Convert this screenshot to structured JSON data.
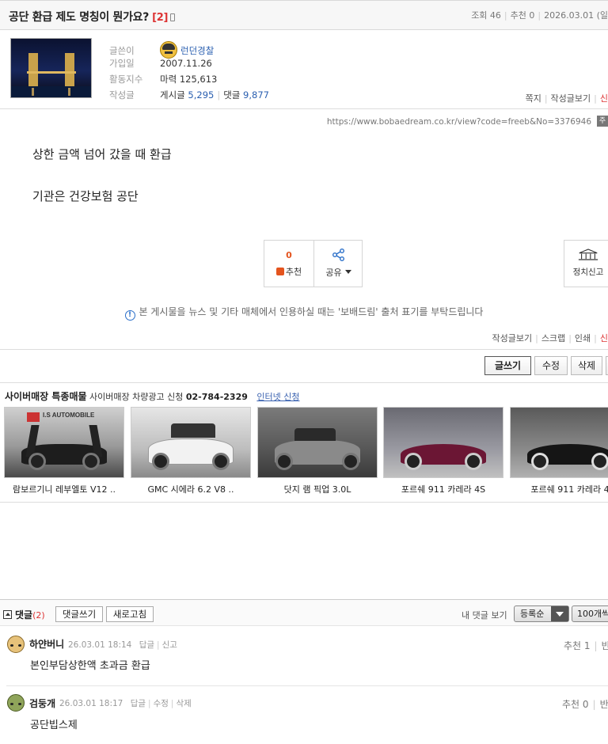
{
  "post": {
    "title": "공단 환급 제도 명칭이 뭔가요?",
    "comment_count": "[2]",
    "views_label": "조회 46",
    "recommend_label": "추천 0",
    "date": "2026.03.01 (일"
  },
  "author": {
    "writer_label": "글쓴이",
    "nickname": "런던경찰",
    "joined_label": "가입일",
    "joined": "2007.11.26",
    "activity_label": "활동지수",
    "activity": "마력 125,613",
    "posts_label": "작성글",
    "posts_prefix": "게시글",
    "posts_count": "5,295",
    "replies_prefix": "댓글",
    "replies_count": "9,877",
    "links": [
      "쪽지",
      "작성글보기",
      "신"
    ]
  },
  "url": "https://www.bobaedream.co.kr/view?code=freeb&No=3376946",
  "url_copy_label": "주",
  "body": {
    "line1": "상한 금액 넘어 갔을 때 환급",
    "line2": "기관은 건강보험 공단"
  },
  "actions": {
    "recommend_count": "0",
    "recommend_label": "추천",
    "share_label": "공유",
    "political_report_label": "정치신고"
  },
  "notice": "본 게시물을 뉴스 및 기타 매체에서 인용하실 때는 '보배드림' 출처 표기를 부탁드립니다",
  "post_tools": [
    "작성글보기",
    "스크랩",
    "인쇄",
    "신"
  ],
  "buttons": {
    "write": "글쓰기",
    "edit": "수정",
    "delete": "삭제"
  },
  "cyber": {
    "title": "사이버매장 특종매물",
    "ad_text": "사이버매장 차량광고 신청",
    "phone": "02-784-2329",
    "online_apply": "인터넷 신청",
    "cars": [
      {
        "caption": "람보르기니 레부엘토 V12 ..",
        "badge": "I.S AUTOMOBILE"
      },
      {
        "caption": "GMC 시에라 6.2 V8 .."
      },
      {
        "caption": "닷지 램 픽업 3.0L"
      },
      {
        "caption": "포르쉐 911 카레라 4S"
      },
      {
        "caption": "포르쉐 911 카레라 4"
      }
    ]
  },
  "comments_bar": {
    "title": "댓글",
    "count": "(2)",
    "write_button": "댓글쓰기",
    "refresh_button": "새로고침",
    "my_comments": "내 댓글 보기",
    "sort_value": "등록순",
    "per_page": "100개씩"
  },
  "comments": [
    {
      "name": "하얀버니",
      "datetime": "26.03.01 18:14",
      "actions": [
        "답글",
        "신고"
      ],
      "recommend": "추천 1",
      "oppose": "반",
      "text": "본인부담상한액 초과금 환급"
    },
    {
      "name": "검둥개",
      "datetime": "26.03.01 18:17",
      "actions": [
        "답글",
        "수정",
        "삭제"
      ],
      "recommend": "추천 0",
      "oppose": "반",
      "text": "공단빕스제"
    }
  ]
}
